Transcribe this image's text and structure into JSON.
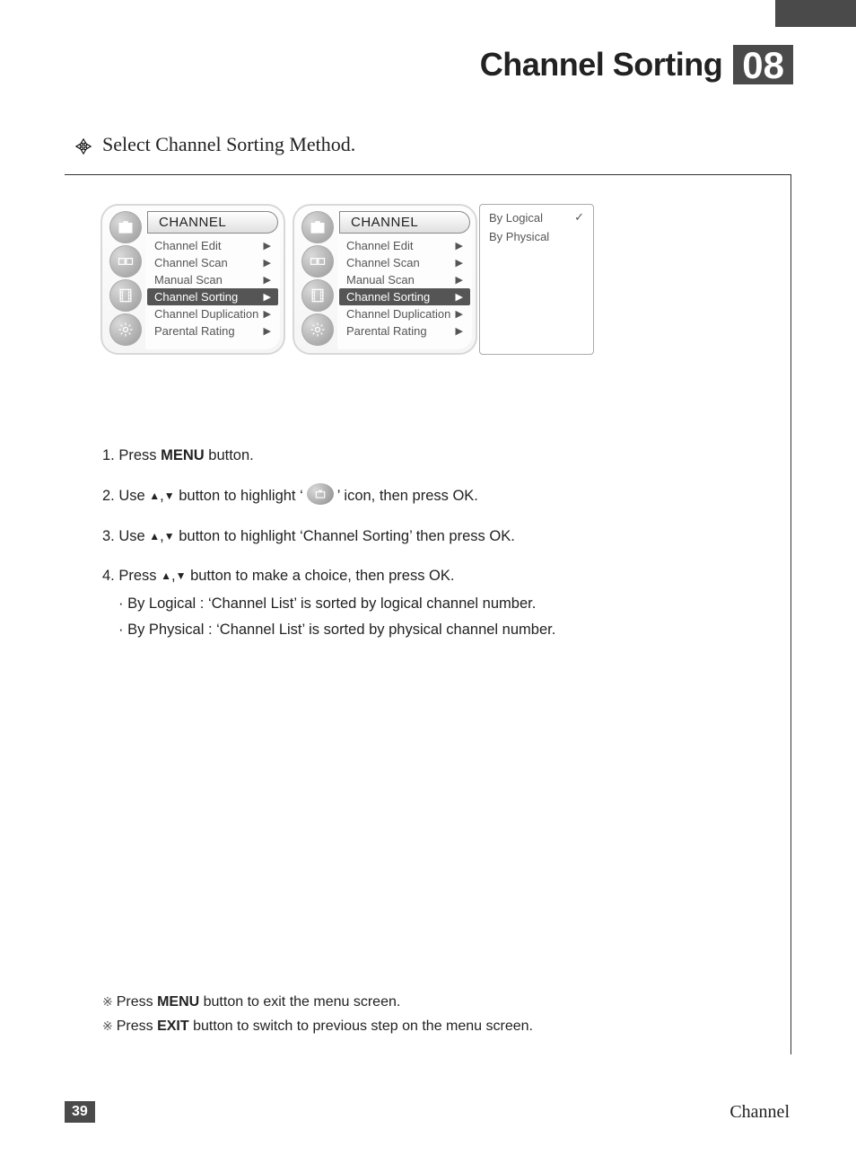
{
  "header": {
    "title": "Channel Sorting",
    "number": "08"
  },
  "subtitle": "Select Channel Sorting Method.",
  "menu": {
    "title": "CHANNEL",
    "items": [
      {
        "label": "Channel Edit",
        "selected": false
      },
      {
        "label": "Channel Scan",
        "selected": false
      },
      {
        "label": "Manual Scan",
        "selected": false
      },
      {
        "label": "Channel Sorting",
        "selected": true
      },
      {
        "label": "Channel Duplication",
        "selected": false
      },
      {
        "label": "Parental Rating",
        "selected": false
      }
    ],
    "submenu": [
      {
        "label": "By Logical",
        "checked": true
      },
      {
        "label": "By Physical",
        "checked": false
      }
    ]
  },
  "steps": {
    "s1_pre": "1. Press ",
    "s1_bold": "MENU",
    "s1_post": " button.",
    "s2_pre": "2. Use ",
    "s2_mid": " button to highlight ‘",
    "s2_post": "’ icon, then press OK.",
    "s3_pre": "3. Use ",
    "s3_post": " button to highlight ‘Channel Sorting’ then press OK.",
    "s4_pre": "4. Press ",
    "s4_post": " button to make a choice, then press OK.",
    "s4_b1": "· By Logical : ‘Channel List’ is sorted by logical channel number.",
    "s4_b2": "· By Physical : ‘Channel List’ is sorted by physical channel number."
  },
  "notes": {
    "n1_pre": "Press ",
    "n1_bold": "MENU",
    "n1_post": " button to exit the menu screen.",
    "n2_pre": "Press ",
    "n2_bold": "EXIT",
    "n2_post": " button to switch to previous step on the menu screen."
  },
  "footer": {
    "page": "39",
    "section": "Channel"
  }
}
